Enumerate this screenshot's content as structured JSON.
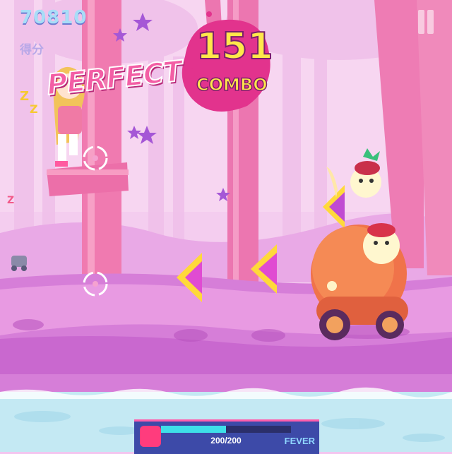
{
  "hud": {
    "score": "70810",
    "score_label": "得分",
    "judgement": "PERFECT",
    "combo_count": "151",
    "combo_label": "COMBO"
  },
  "fever": {
    "hp_text": "200/200",
    "label": "FEVER",
    "fill_fraction": 0.5
  },
  "colors": {
    "sky": "#f3c6ef",
    "ground": "#d07ad6",
    "water": "#bfe6f2",
    "accent": "#ff5dab",
    "score": "#a8ddf7",
    "combo": "#ffe84a"
  }
}
